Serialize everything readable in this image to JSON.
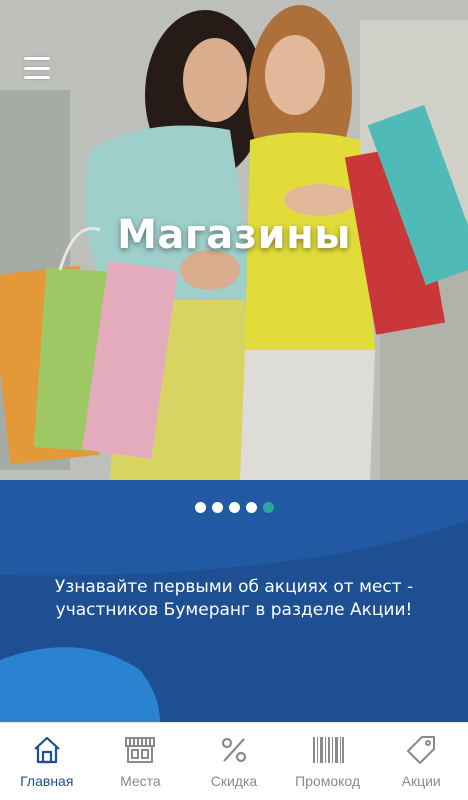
{
  "hero": {
    "title": "Магазины",
    "menu_icon": "hamburger-menu-icon"
  },
  "carousel": {
    "total": 5,
    "active_index": 4,
    "active_color": "#2aa7a0",
    "inactive_color": "#ffffff"
  },
  "promo": {
    "line1": "Узнавайте первыми об акциях от мест -",
    "line2": "участников Бумеранг в разделе Акции!",
    "background": "#1f4f93"
  },
  "nav": {
    "items": [
      {
        "label": "Главная",
        "icon": "home-icon",
        "active": true
      },
      {
        "label": "Места",
        "icon": "store-icon",
        "active": false
      },
      {
        "label": "Скидка",
        "icon": "percent-icon",
        "active": false
      },
      {
        "label": "Промокод",
        "icon": "barcode-icon",
        "active": false
      },
      {
        "label": "Акции",
        "icon": "tag-icon",
        "active": false
      }
    ],
    "active_color": "#1f4f93",
    "inactive_color": "#8a8a8a"
  }
}
